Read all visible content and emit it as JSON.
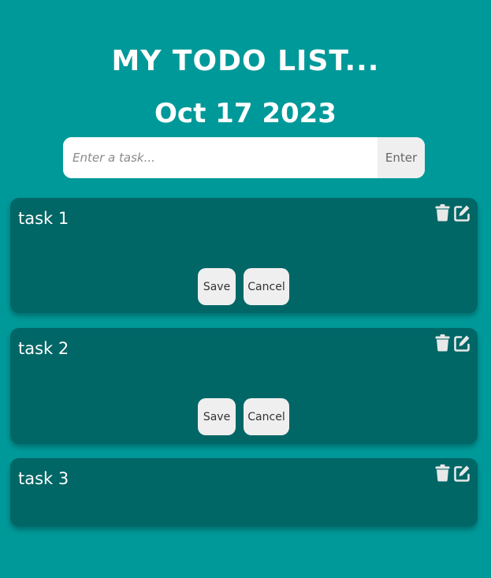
{
  "header": {
    "title": "MY TODO LIST...",
    "date": "Oct 17 2023"
  },
  "add_task": {
    "placeholder": "Enter a task...",
    "button_label": "Enter"
  },
  "colors": {
    "background": "#009999",
    "card": "#006666",
    "button": "#efefef",
    "icon": "#e8e8e8"
  },
  "icons": {
    "delete": "trash-icon",
    "edit": "edit-icon"
  },
  "tasks": [
    {
      "text": "task 1",
      "editing": true,
      "save_label": "Save",
      "cancel_label": "Cancel"
    },
    {
      "text": "task 2",
      "editing": true,
      "save_label": "Save",
      "cancel_label": "Cancel"
    },
    {
      "text": "task 3",
      "editing": false
    }
  ]
}
